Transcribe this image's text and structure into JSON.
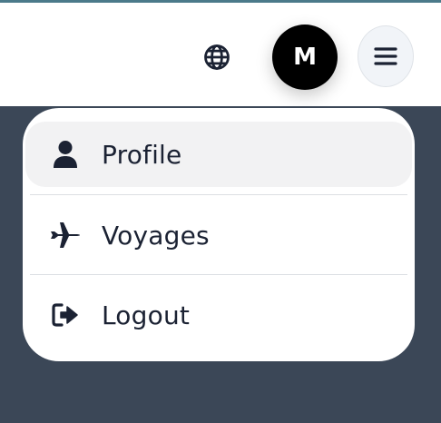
{
  "header": {
    "language_icon": "globe-icon",
    "avatar_initial": "M",
    "menu_icon": "hamburger-menu-icon"
  },
  "menu": {
    "items": [
      {
        "label": "Profile",
        "icon": "user-icon",
        "active": true
      },
      {
        "label": "Voyages",
        "icon": "airplane-icon",
        "active": false
      },
      {
        "label": "Logout",
        "icon": "logout-icon",
        "active": false
      }
    ]
  },
  "colors": {
    "page_background": "#3b4757",
    "top_stripe": "#4b7a8a",
    "text": "#1b2233",
    "active_item_background": "#f2f2f3",
    "avatar_background": "#000000",
    "menu_button_background": "#f1f4f8"
  }
}
